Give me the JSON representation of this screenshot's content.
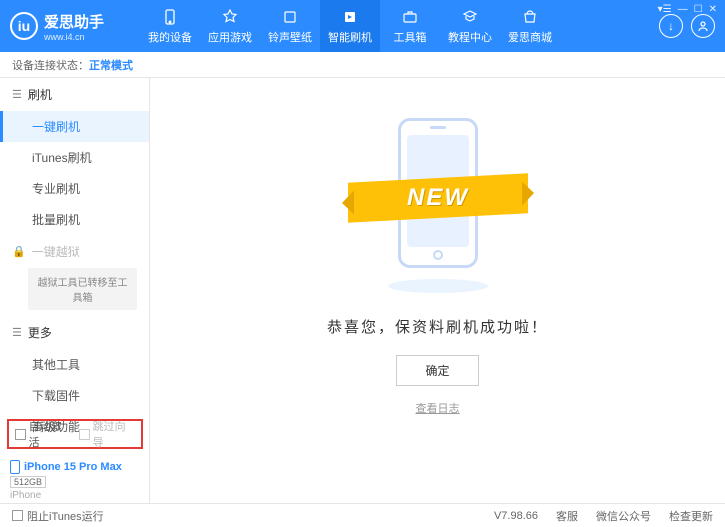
{
  "header": {
    "app_name": "爱思助手",
    "app_url": "www.i4.cn",
    "logo_letter": "iu",
    "nav": [
      {
        "label": "我的设备"
      },
      {
        "label": "应用游戏"
      },
      {
        "label": "铃声壁纸"
      },
      {
        "label": "智能刷机"
      },
      {
        "label": "工具箱"
      },
      {
        "label": "教程中心"
      },
      {
        "label": "爱思商城"
      }
    ]
  },
  "status": {
    "label": "设备连接状态：",
    "mode": "正常模式"
  },
  "sidebar": {
    "group1": {
      "title": "刷机"
    },
    "items1": [
      {
        "label": "一键刷机"
      },
      {
        "label": "iTunes刷机"
      },
      {
        "label": "专业刷机"
      },
      {
        "label": "批量刷机"
      }
    ],
    "jailbreak_title": "一键越狱",
    "jailbreak_note": "越狱工具已转移至工具箱",
    "group2": {
      "title": "更多"
    },
    "items2": [
      {
        "label": "其他工具"
      },
      {
        "label": "下载固件"
      },
      {
        "label": "高级功能"
      }
    ],
    "checks": {
      "auto_activate": "自动激活",
      "skip_guide": "跳过向导"
    },
    "device": {
      "name": "iPhone 15 Pro Max",
      "storage": "512GB",
      "type": "iPhone"
    }
  },
  "main": {
    "ribbon": "NEW",
    "success": "恭喜您，保资料刷机成功啦！",
    "ok": "确定",
    "log": "查看日志"
  },
  "footer": {
    "block_itunes": "阻止iTunes运行",
    "version": "V7.98.66",
    "links": [
      "客服",
      "微信公众号",
      "检查更新"
    ]
  }
}
